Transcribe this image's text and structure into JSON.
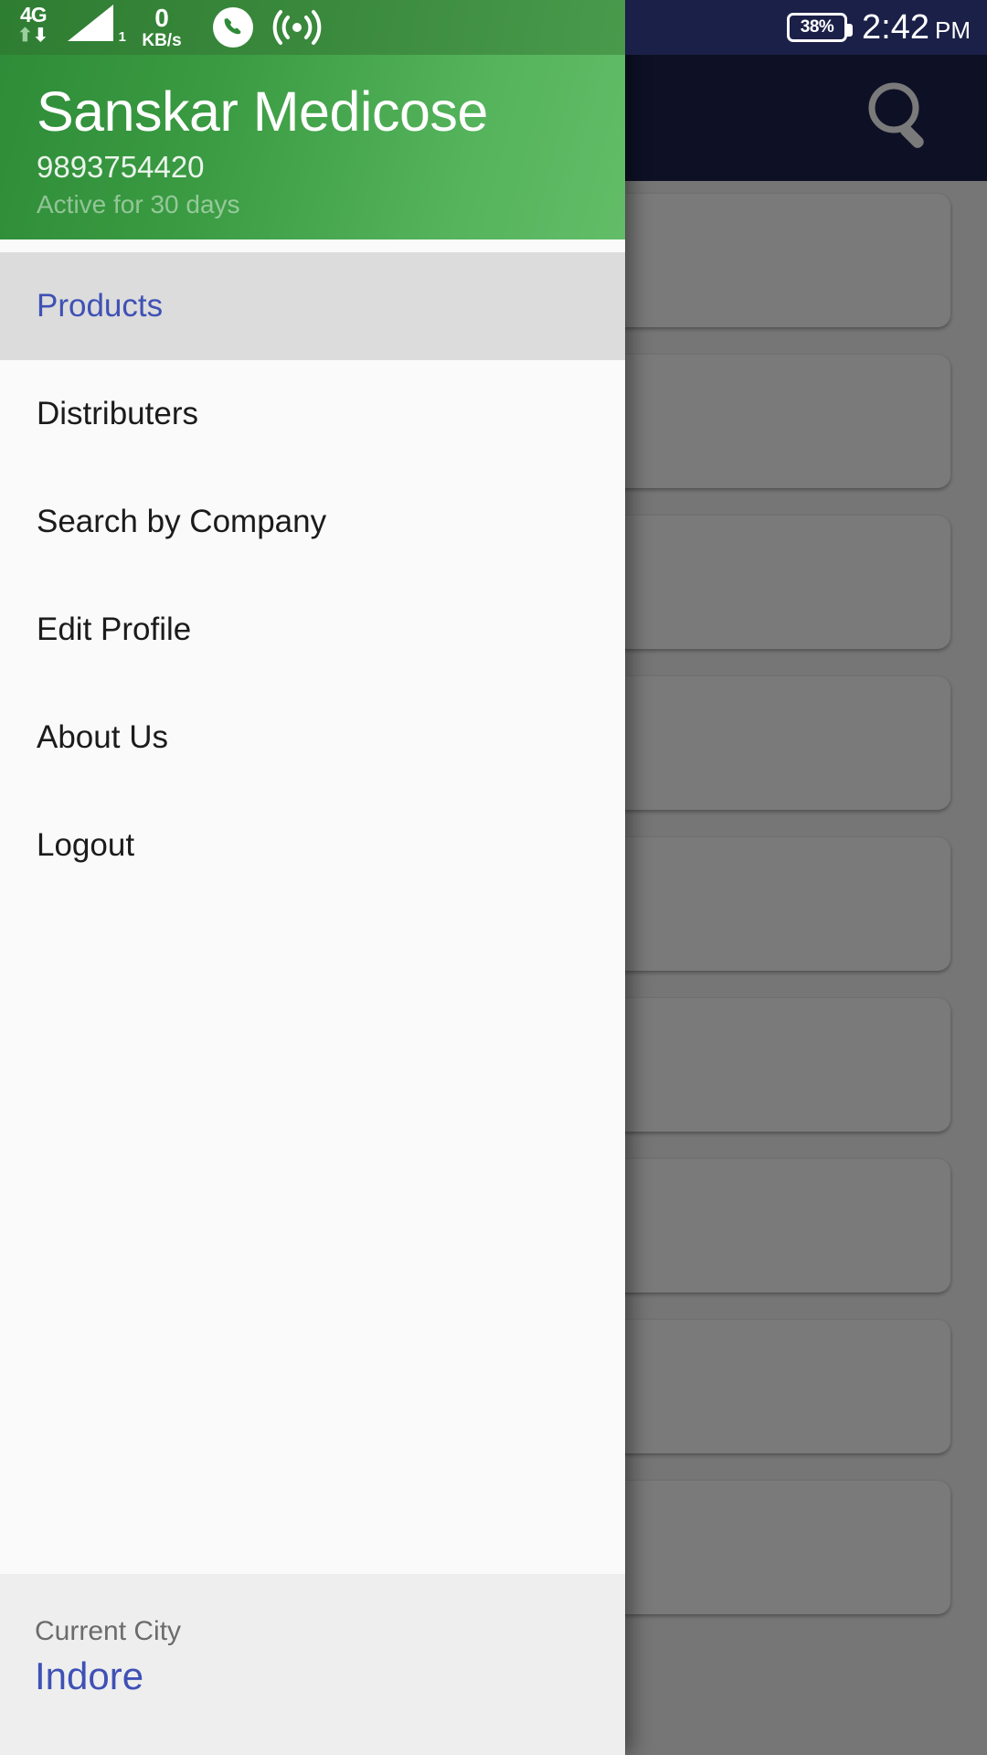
{
  "status_bar": {
    "network_type": "4G",
    "signal_slot": "1",
    "data_rate_value": "0",
    "data_rate_unit": "KB/s",
    "call_icon": "phone-icon",
    "cast_icon": "broadcast-icon",
    "battery_percent": "38%",
    "time": "2:42",
    "am_pm": "PM"
  },
  "app_bar": {
    "search_icon": "search-icon"
  },
  "drawer": {
    "header": {
      "title": "Sanskar Medicose",
      "phone": "9893754420",
      "subscription": "Active for 30 days"
    },
    "menu_items": [
      {
        "label": "Products",
        "active": true
      },
      {
        "label": "Distributers",
        "active": false
      },
      {
        "label": "Search by Company",
        "active": false
      },
      {
        "label": "Edit Profile",
        "active": false
      },
      {
        "label": "About Us",
        "active": false
      },
      {
        "label": "Logout",
        "active": false
      }
    ],
    "footer": {
      "label": "Current City",
      "value": "Indore"
    }
  },
  "colors": {
    "drawer_header_green": "#3a9b42",
    "app_bar_navy": "#1e2450",
    "accent_indigo": "#3f51b5",
    "active_item_bg": "#dcdcdc",
    "footer_bg": "#eeeeee"
  },
  "background_cards_count": 9
}
